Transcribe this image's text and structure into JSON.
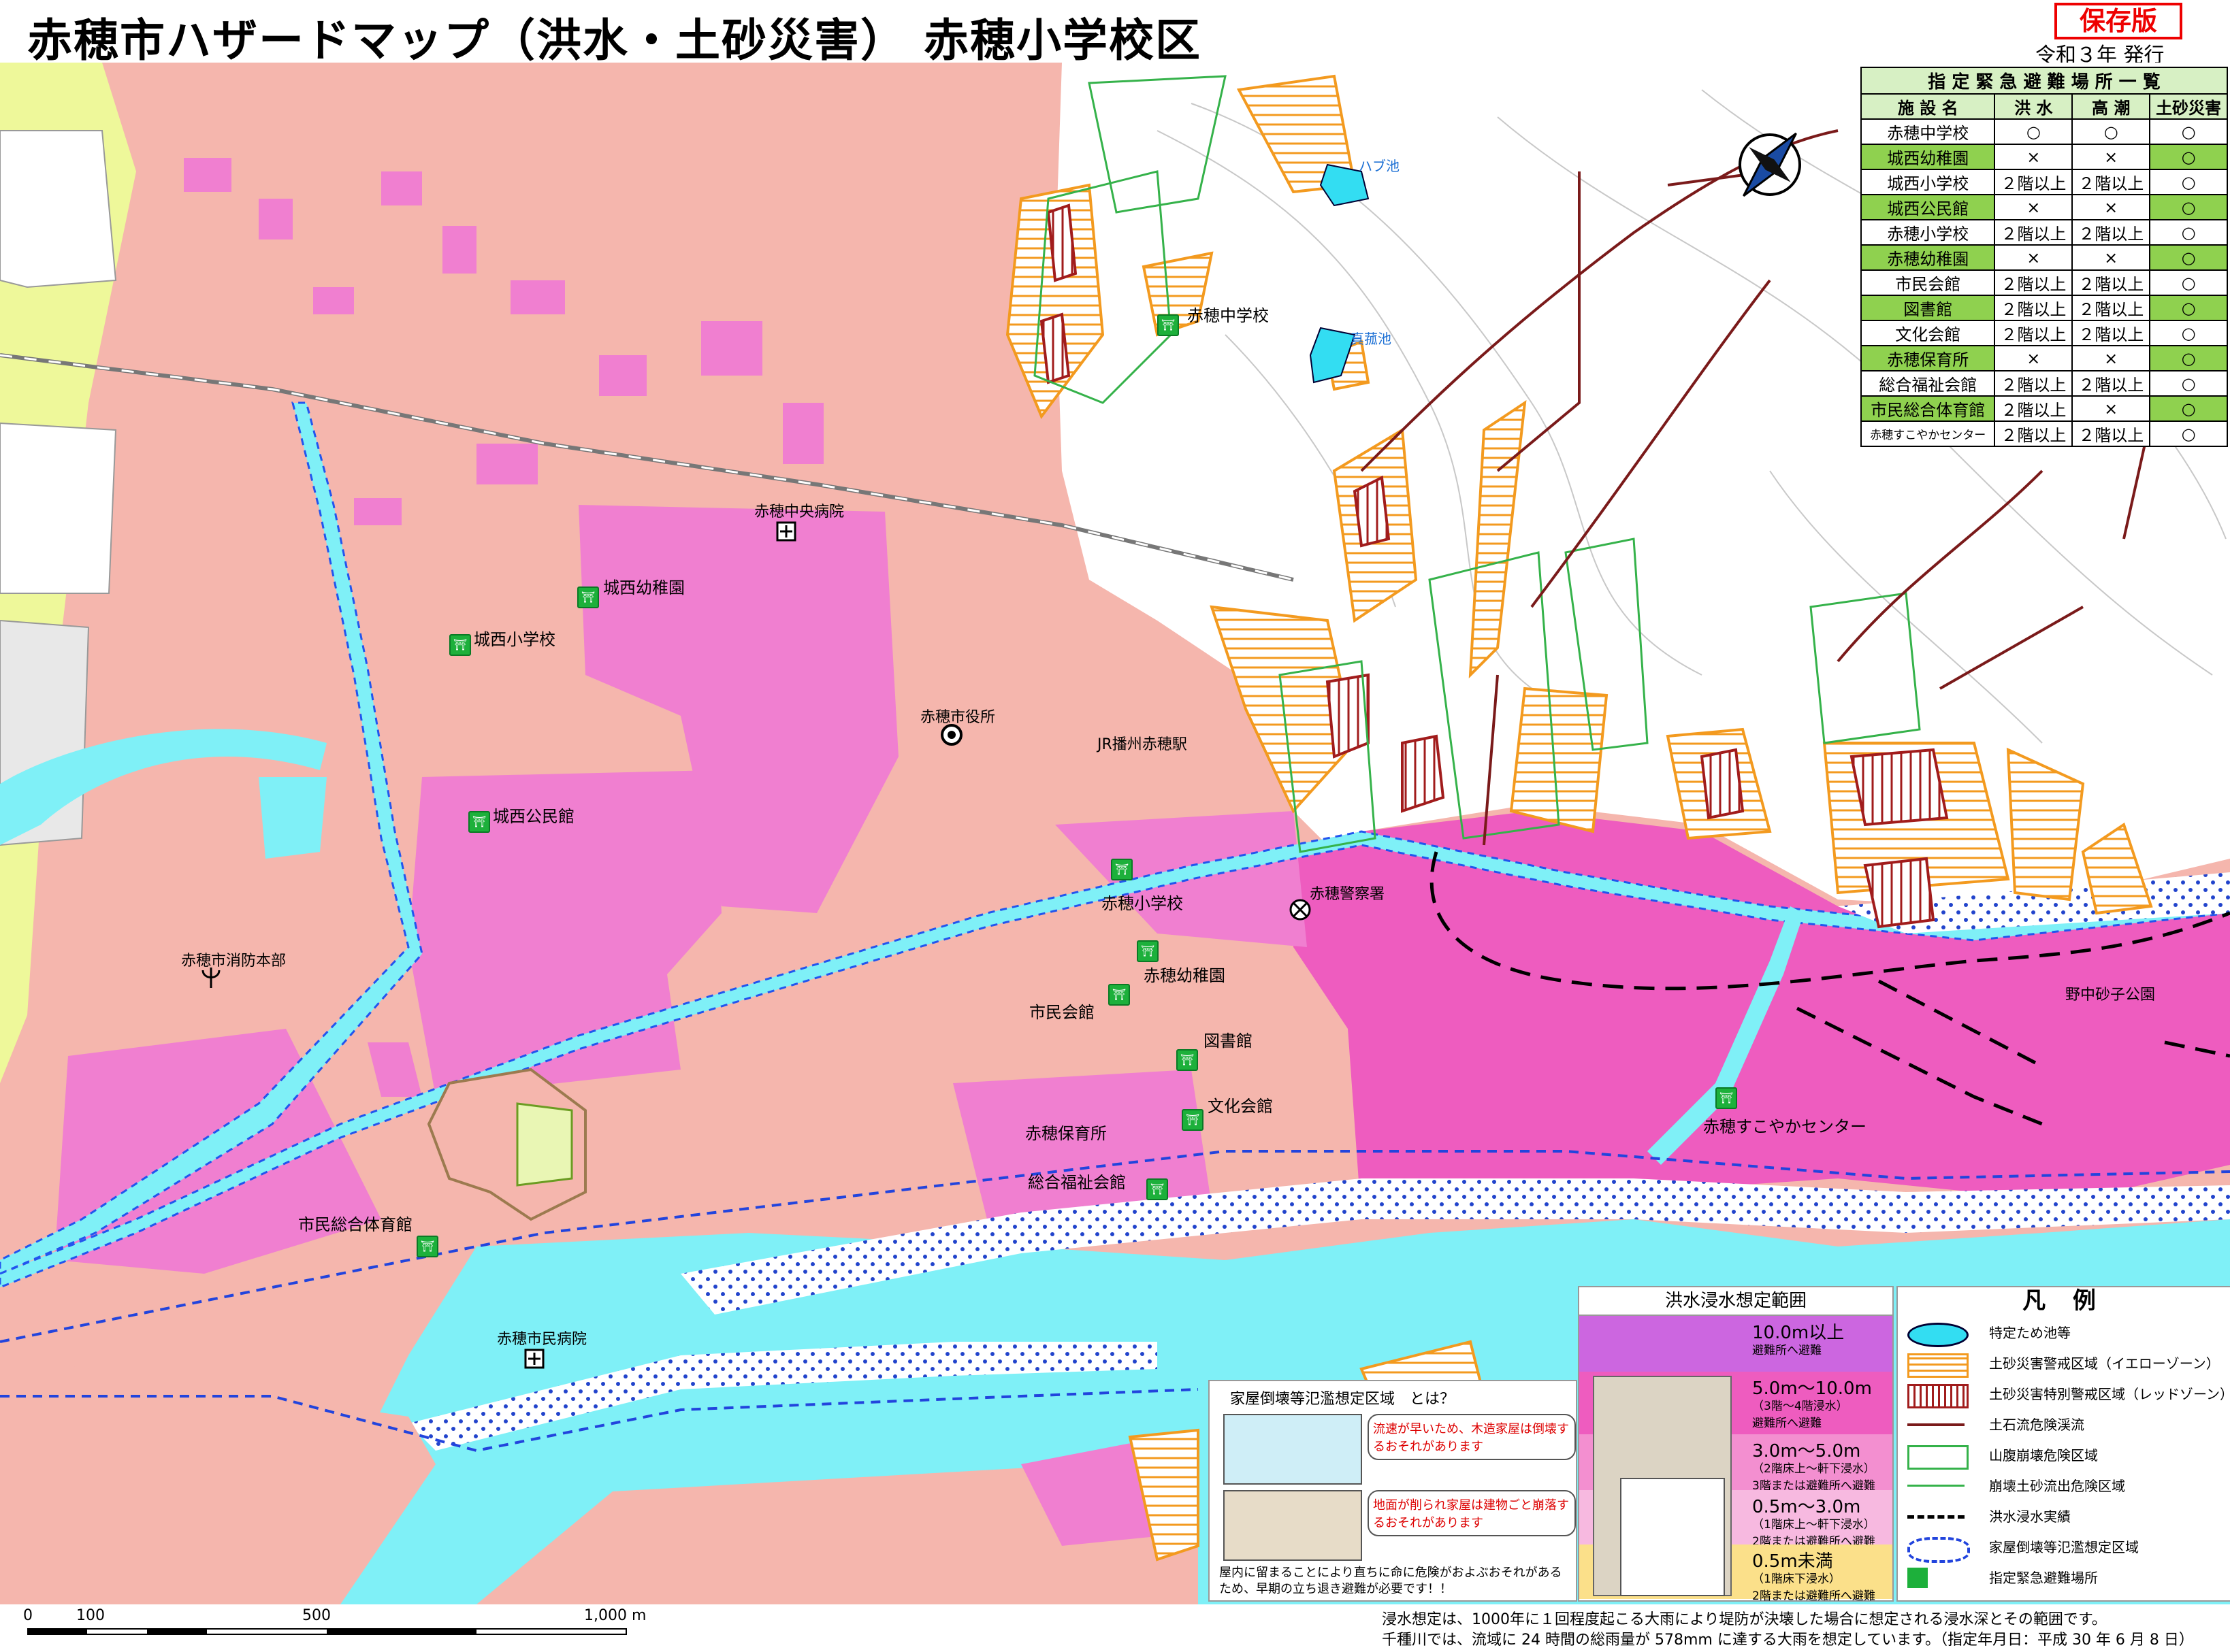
{
  "header": {
    "title": "赤穂市ハザードマップ（洪水・土砂災害） 赤穂小学校区",
    "edition_badge": "保存版",
    "issued": "令和３年 発行"
  },
  "colors": {
    "land_pink": "#f5b6ad",
    "flood_magenta": "#f2a1d4",
    "deep_flood": "#ee5cbf",
    "river": "#7ff0f7",
    "hillshade": "#ffffff",
    "yellow_zone": "#f39a1f",
    "red_zone": "#a11c1c",
    "landslide_green": "#35b24a",
    "debris_arrow": "#7a1a1a"
  },
  "map_labels": {
    "hospital_central": "赤穂中央病院",
    "city_hall": "赤穂市役所",
    "station": "JR播州赤穂駅",
    "police": "赤穂警察署",
    "fire_hq": "赤穂市消防本部",
    "city_hospital": "赤穂市民病院",
    "pond_habu": "ハブ池",
    "pond_mako": "真菰池",
    "park_nonaka": "野中砂子公園",
    "school_ako_jh": "赤穂中学校",
    "kindergarten_josei": "城西幼稚園",
    "school_josei": "城西小学校",
    "hall_josei": "城西公民館",
    "school_ako_el": "赤穂小学校",
    "kindergarten_ako": "赤穂幼稚園",
    "civic_hall": "市民会館",
    "library": "図書館",
    "culture_hall": "文化会館",
    "nursery_ako": "赤穂保育所",
    "welfare_hall": "総合福祉会館",
    "gymnasium": "市民総合体育館",
    "sukoyaka": "赤穂すこやかセンター"
  },
  "shelter_table": {
    "title": "指 定 緊 急 避 難 場 所 一 覧",
    "columns": [
      "施 設 名",
      "洪 水",
      "高 潮",
      "土砂災害"
    ],
    "rows": [
      {
        "name": "赤穂中学校",
        "flood": "○",
        "surge": "○",
        "landslide": "○",
        "highlight": false
      },
      {
        "name": "城西幼稚園",
        "flood": "×",
        "surge": "×",
        "landslide": "○",
        "highlight": true
      },
      {
        "name": "城西小学校",
        "flood": "２階以上",
        "surge": "２階以上",
        "landslide": "○",
        "highlight": false
      },
      {
        "name": "城西公民館",
        "flood": "×",
        "surge": "×",
        "landslide": "○",
        "highlight": true
      },
      {
        "name": "赤穂小学校",
        "flood": "２階以上",
        "surge": "２階以上",
        "landslide": "○",
        "highlight": false
      },
      {
        "name": "赤穂幼稚園",
        "flood": "×",
        "surge": "×",
        "landslide": "○",
        "highlight": true
      },
      {
        "name": "市民会館",
        "flood": "２階以上",
        "surge": "２階以上",
        "landslide": "○",
        "highlight": false
      },
      {
        "name": "図書館",
        "flood": "２階以上",
        "surge": "２階以上",
        "landslide": "○",
        "highlight": true
      },
      {
        "name": "文化会館",
        "flood": "２階以上",
        "surge": "２階以上",
        "landslide": "○",
        "highlight": false
      },
      {
        "name": "赤穂保育所",
        "flood": "×",
        "surge": "×",
        "landslide": "○",
        "highlight": true
      },
      {
        "name": "総合福祉会館",
        "flood": "２階以上",
        "surge": "２階以上",
        "landslide": "○",
        "highlight": false
      },
      {
        "name": "市民総合体育館",
        "flood": "２階以上",
        "surge": "×",
        "landslide": "○",
        "highlight": true
      },
      {
        "name": "赤穂すこやかセンター",
        "flood": "２階以上",
        "surge": "２階以上",
        "landslide": "○",
        "highlight": false
      }
    ]
  },
  "flood_panel": {
    "title": "洪水浸水想定範囲",
    "bands": [
      {
        "depth": "10.0m以上",
        "note": "避難所へ避難",
        "color": "#cc66e0"
      },
      {
        "depth": "5.0m〜10.0m",
        "note": "（3階〜4階浸水）\n避難所へ避難",
        "color": "#ee5cbf"
      },
      {
        "depth": "3.0m〜5.0m",
        "note": "（2階床上〜軒下浸水）\n3階または避難所へ避難",
        "color": "#f38fd0"
      },
      {
        "depth": "0.5m〜3.0m",
        "note": "（1階床上〜軒下浸水）\n2階または避難所へ避難",
        "color": "#f7b9e0"
      },
      {
        "depth": "0.5m未満",
        "note": "（1階床下浸水）\n2階または避難所へ避難",
        "color": "#fbe08a"
      }
    ]
  },
  "collapse_box": {
    "title": "家屋倒壊等氾濫想定区域　とは？",
    "item1": "流速が早いため、木造家屋は倒壊するおそれがあります",
    "item2": "地面が削られ家屋は建物ごと崩落するおそれがあります",
    "footer": "屋内に留まることにより直ちに命に危険がおよぶおそれがあるため、早期の立ち退き避難が必要です！！"
  },
  "legend": {
    "title": "凡 例",
    "items": [
      {
        "label": "特定ため池等",
        "symbol": "pond"
      },
      {
        "label": "土砂災害警戒区域（イエローゾーン）",
        "symbol": "yellow-zone"
      },
      {
        "label": "土砂災害特別警戒区域（レッドゾーン）",
        "symbol": "red-zone"
      },
      {
        "label": "土石流危険渓流",
        "symbol": "debris-arrow"
      },
      {
        "label": "山腹崩壊危険区域",
        "symbol": "green-box"
      },
      {
        "label": "崩壊土砂流出危険区域",
        "symbol": "green-arrow"
      },
      {
        "label": "洪水浸水実績",
        "symbol": "dash-line"
      },
      {
        "label": "家屋倒壊等氾濫想定区域",
        "symbol": "blue-dash"
      },
      {
        "label": "指定緊急避難場所",
        "symbol": "shelter"
      }
    ]
  },
  "scale": {
    "ticks": [
      "0",
      "100",
      "500",
      "1,000 m"
    ]
  },
  "footnote": {
    "line1": "浸水想定は、1000年に１回程度起こる大雨により堤防が決壊した場合に想定される浸水深とその範囲です。",
    "line2": "千種川では、流域に 24 時間の総雨量が 578mm に達する大雨を想定しています。（指定年月日：平成 30 年 6 月 8 日）"
  }
}
